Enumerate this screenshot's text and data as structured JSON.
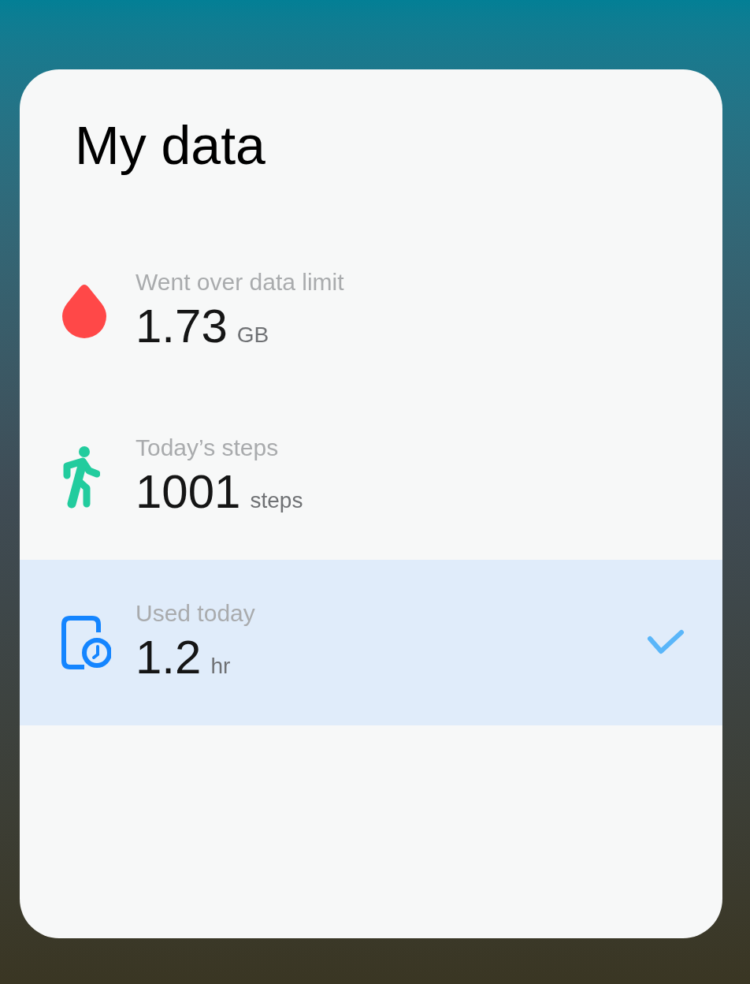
{
  "card": {
    "title": "My data"
  },
  "items": [
    {
      "kind": "drop",
      "label": "Went over data limit",
      "value": "1.73",
      "unit": "GB",
      "selected": false
    },
    {
      "kind": "walker",
      "label": "Today’s steps",
      "value": "1001",
      "unit": "steps",
      "selected": false
    },
    {
      "kind": "phone-clock",
      "label": "Used today",
      "value": "1.2",
      "unit": "hr",
      "selected": true
    }
  ]
}
